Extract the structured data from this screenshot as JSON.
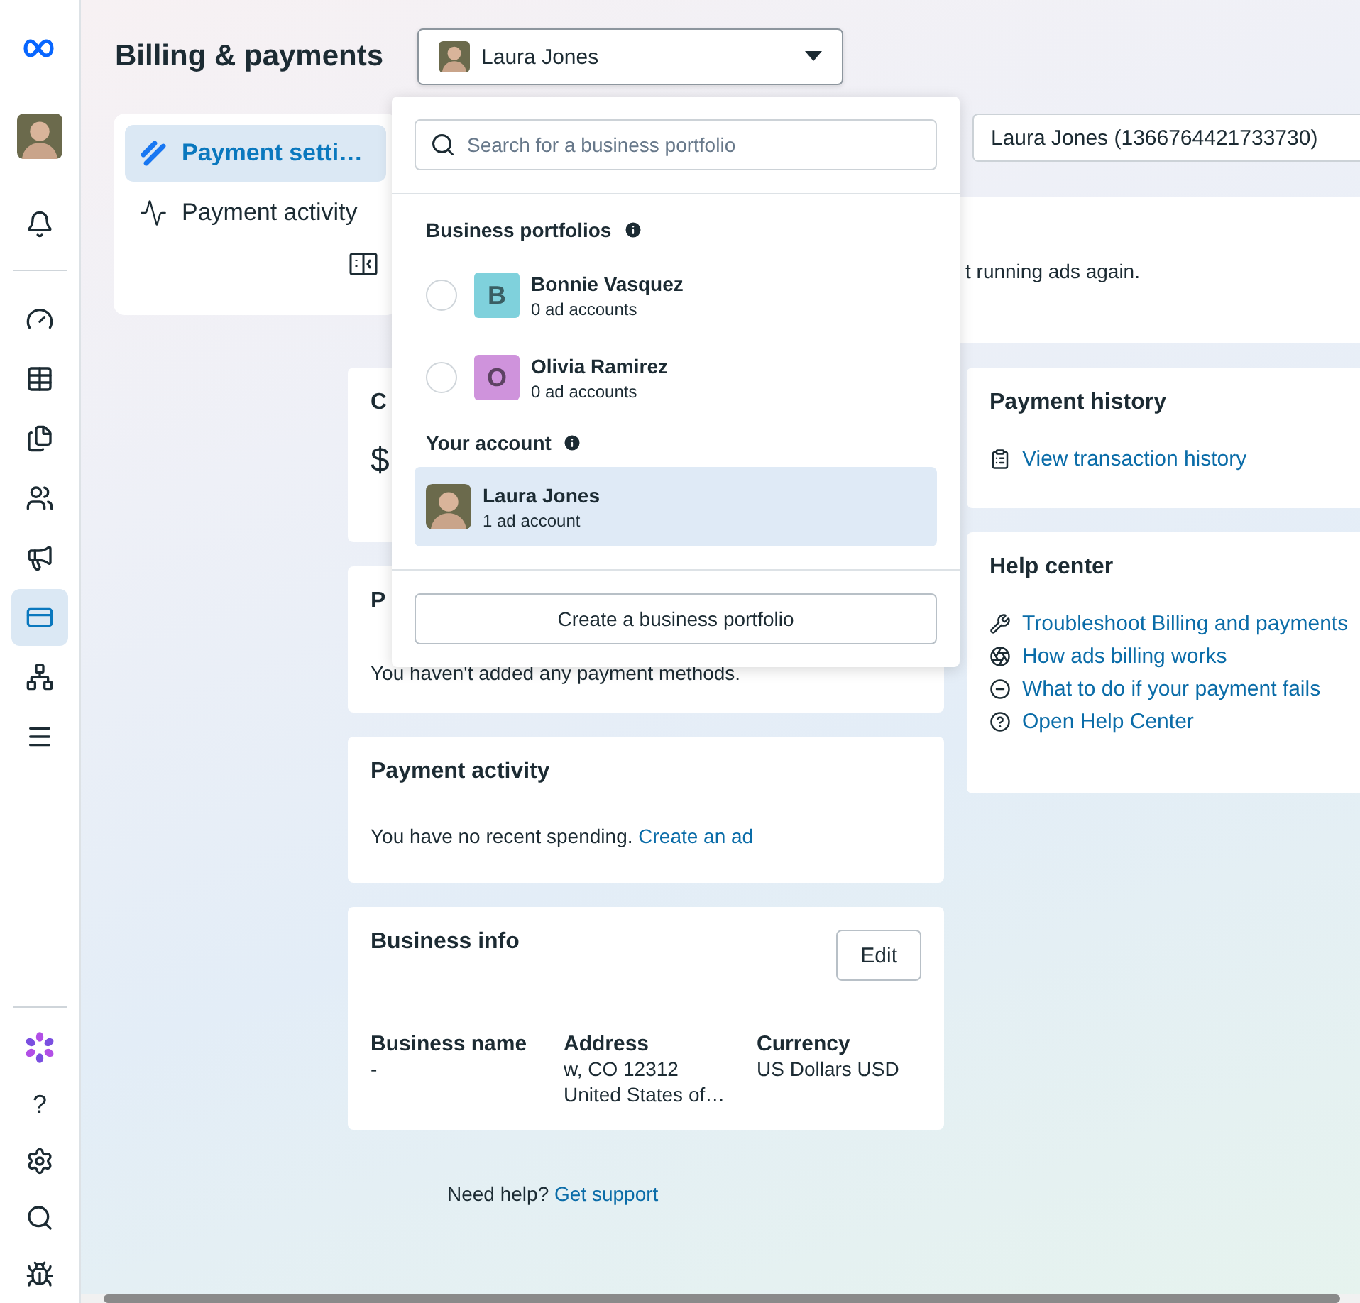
{
  "rail": {
    "top": [
      {
        "kind": "logo",
        "selected": false
      },
      {
        "kind": "avatar",
        "selected": false
      },
      {
        "kind": "bell",
        "selected": false
      }
    ],
    "middle": [
      {
        "kind": "gauge",
        "selected": false
      },
      {
        "kind": "table",
        "selected": false
      },
      {
        "kind": "documents",
        "selected": false
      },
      {
        "kind": "people",
        "selected": false
      },
      {
        "kind": "megaphone",
        "selected": false
      },
      {
        "kind": "card",
        "selected": true
      },
      {
        "kind": "network",
        "selected": false
      },
      {
        "kind": "menu",
        "selected": false
      }
    ],
    "bottom": [
      {
        "kind": "flower"
      },
      {
        "kind": "text",
        "label": "?"
      },
      {
        "kind": "settings"
      },
      {
        "kind": "search"
      },
      {
        "kind": "bug"
      }
    ]
  },
  "header": {
    "title": "Billing & payments",
    "account_select": {
      "value": "Laura Jones",
      "expanded": true
    }
  },
  "nav": {
    "items": [
      {
        "label": "Payment setti…",
        "kind": "settings",
        "selected": true
      },
      {
        "label": "Payment activity",
        "kind": "activity",
        "selected": false
      }
    ]
  },
  "ad_account_select": {
    "value": "Laura Jones (1366764421733730)"
  },
  "banner": {
    "text": "t running ads again."
  },
  "covered_cards": [
    {
      "title": "C",
      "value": "$"
    },
    {
      "title": "P",
      "text": "You haven't added any payment methods."
    }
  ],
  "payment_activity": {
    "title": "Payment activity",
    "text": "You have no recent spending.",
    "link": "Create an ad"
  },
  "business_info": {
    "title": "Business info",
    "edit_button": "Edit",
    "fields": [
      {
        "label": "Business name",
        "lines": [
          "-"
        ]
      },
      {
        "label": "Address",
        "lines": [
          "w, CO 12312",
          "United States of…"
        ]
      },
      {
        "label": "Currency",
        "lines": [
          "US Dollars USD"
        ]
      }
    ]
  },
  "support": {
    "text": "Need help?",
    "link": "Get support"
  },
  "payment_history": {
    "title": "Payment history",
    "link": "View transaction history"
  },
  "help_center": {
    "title": "Help center",
    "links": [
      {
        "kind": "tools",
        "label": "Troubleshoot Billing and payments"
      },
      {
        "kind": "circles",
        "label": "How ads billing works"
      },
      {
        "kind": "minus",
        "label": "What to do if your payment fails"
      },
      {
        "kind": "help",
        "label": "Open Help Center"
      }
    ]
  },
  "dropdown": {
    "placeholder": "Search for a business portfolio",
    "sections": [
      {
        "title": "Business portfolios",
        "items": [
          {
            "kind": "letter",
            "letter": "B",
            "color": "#7fd1dc",
            "name": "Bonnie Vasquez",
            "subtitle": "0 ad accounts",
            "selected": false
          },
          {
            "kind": "letter",
            "letter": "O",
            "color": "#cf93dc",
            "name": "Olivia Ramirez",
            "subtitle": "0 ad accounts",
            "selected": false
          }
        ]
      },
      {
        "title": "Your account",
        "items": [
          {
            "kind": "avatar",
            "name": "Laura Jones",
            "subtitle": "1 ad account",
            "selected": true
          }
        ]
      }
    ],
    "create_button": "Create a business portfolio"
  }
}
